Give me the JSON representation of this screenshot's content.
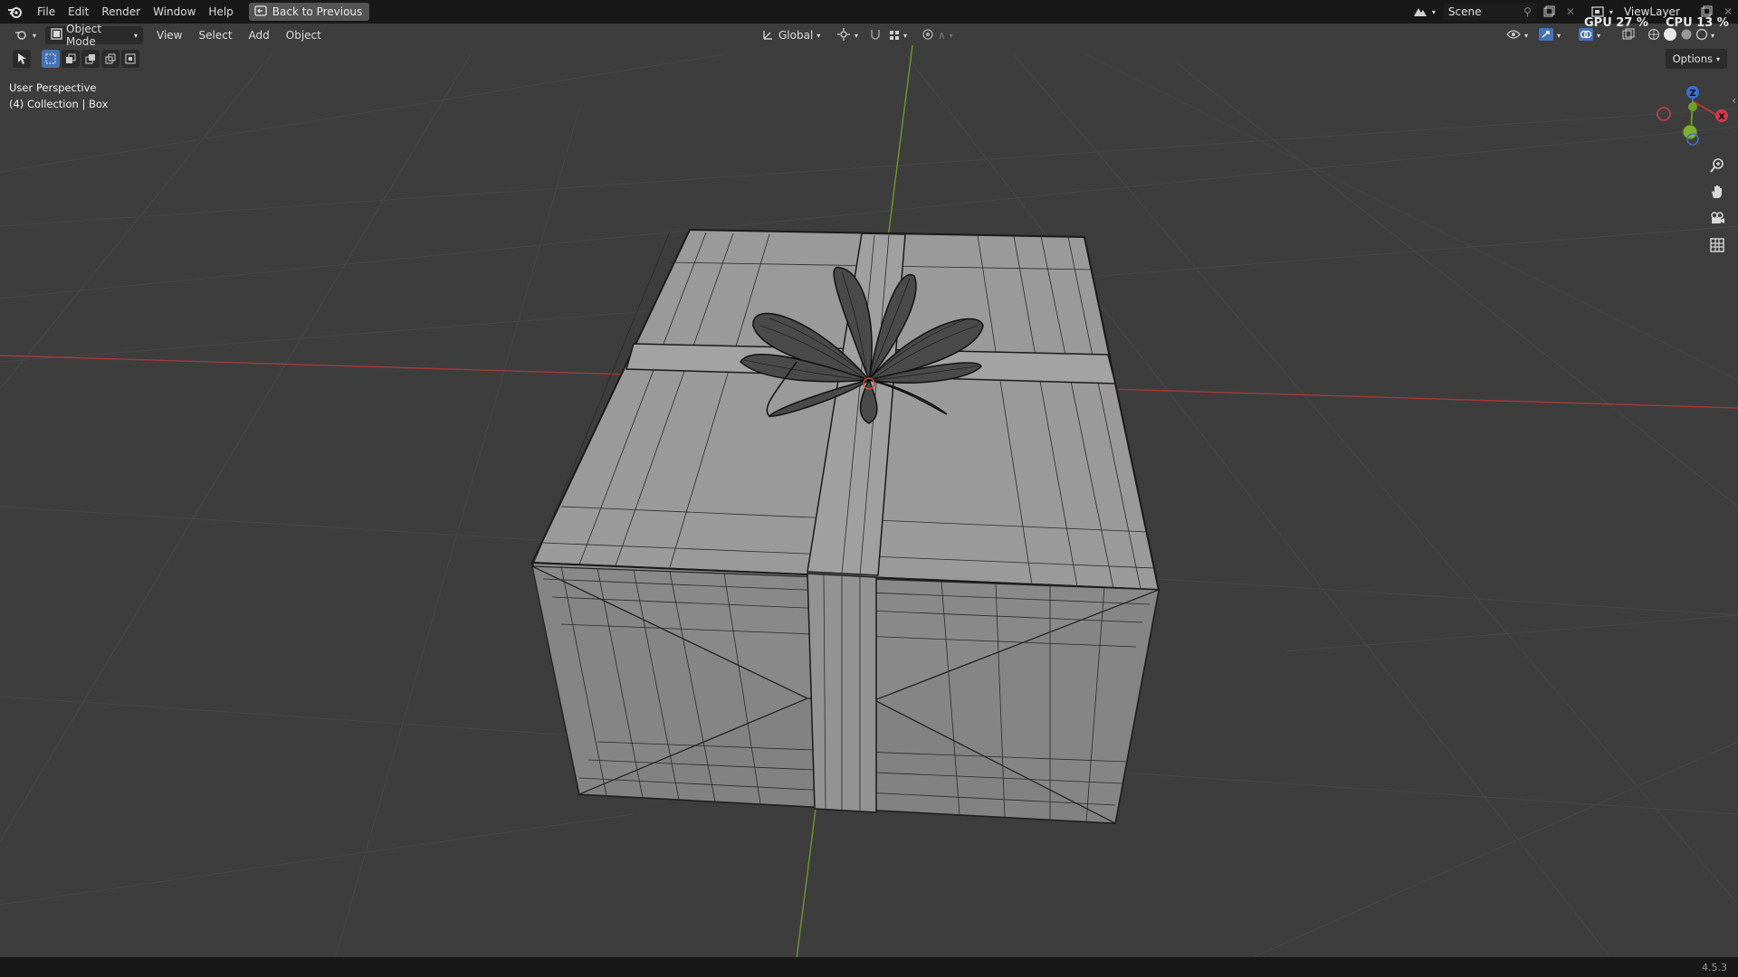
{
  "menubar": {
    "items": [
      "File",
      "Edit",
      "Render",
      "Window",
      "Help"
    ],
    "back_button": "Back to Previous"
  },
  "top_right": {
    "scene": "Scene",
    "view_layer": "ViewLayer",
    "gpu": "GPU 27 %",
    "cpu": "CPU 13 %"
  },
  "viewport_header": {
    "mode": "Object Mode",
    "menus": [
      "View",
      "Select",
      "Add",
      "Object"
    ],
    "orientation": "Global"
  },
  "overlay": {
    "view_name": "User Perspective",
    "collection": "(4) Collection | Box"
  },
  "options_label": "Options",
  "gizmo": {
    "z": "Z",
    "x": "X"
  },
  "version": "4.5.3",
  "colors": {
    "x_axis": "#b03a3a",
    "y_axis": "#6a9a2a",
    "selection": "#4772b3"
  },
  "icons": [
    "blender-icon",
    "back-icon",
    "editor-type-icon",
    "object-mode-icon",
    "transform-icon",
    "pivot-icon",
    "snap-icon",
    "proportional-icon",
    "visibility-icon",
    "gizmo-icon",
    "overlay-icon",
    "xray-icon",
    "shading-solid-icon",
    "zoom-icon",
    "hand-icon",
    "camera-icon",
    "grid-icon"
  ]
}
